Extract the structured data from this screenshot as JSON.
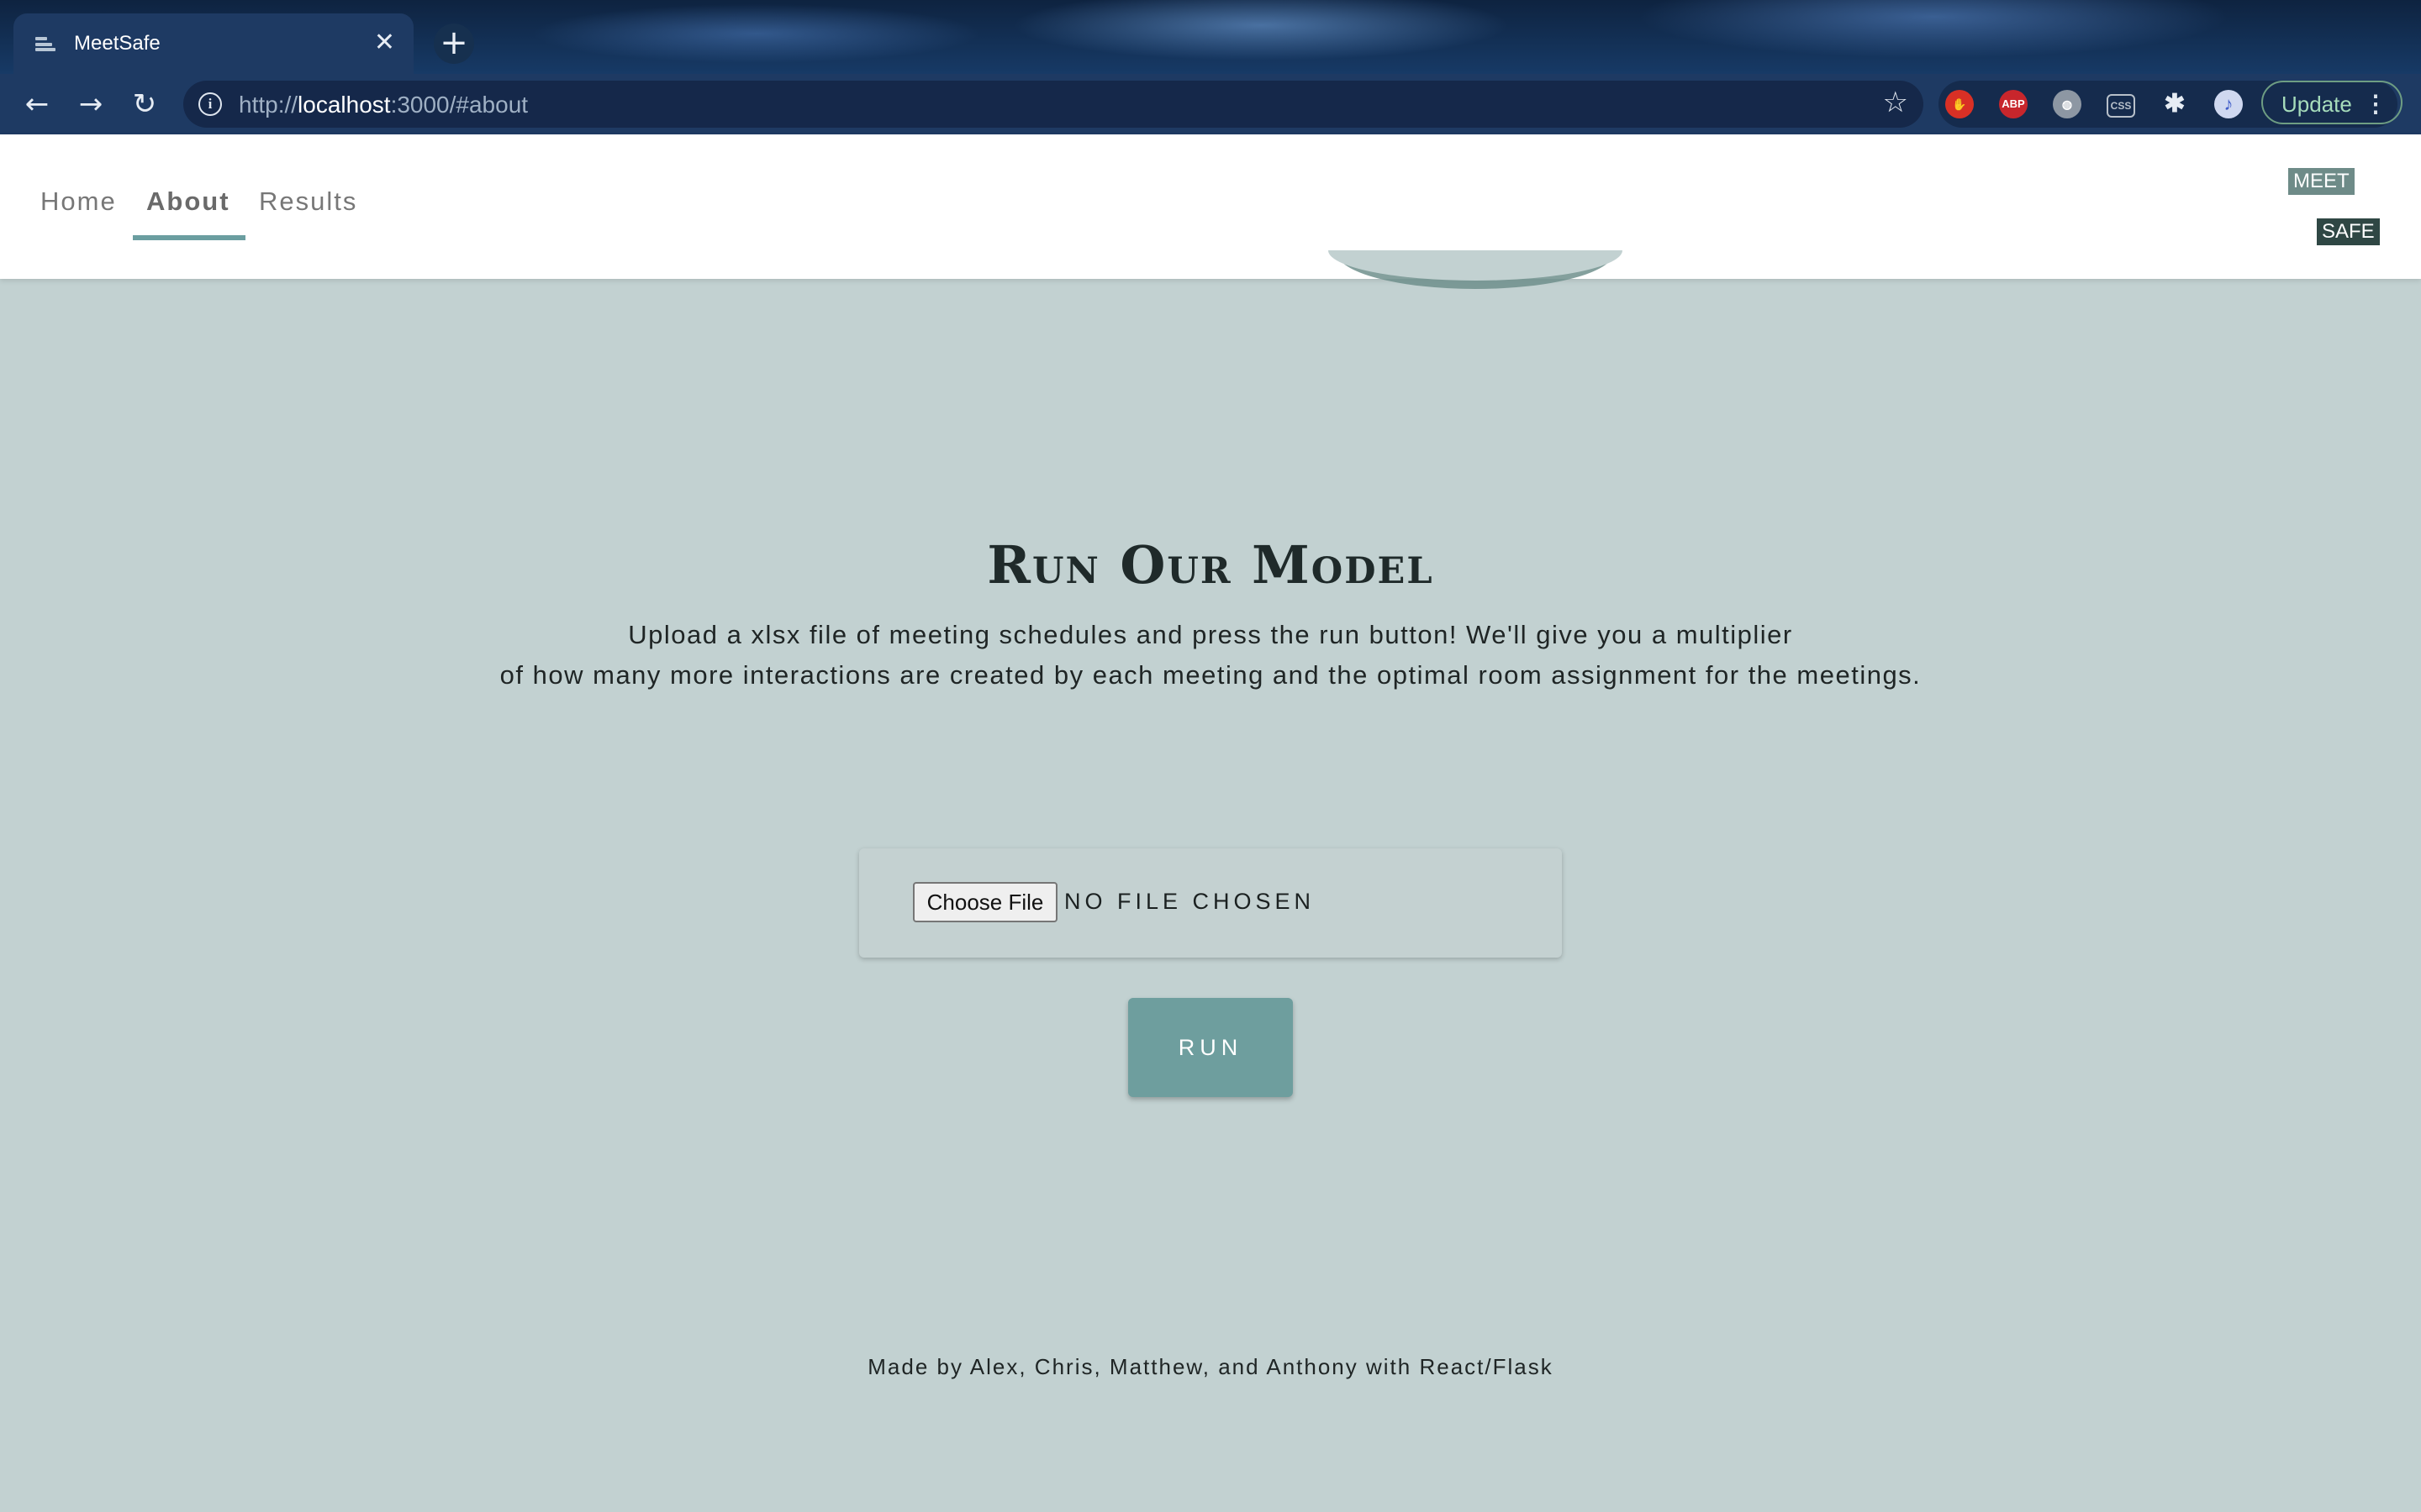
{
  "browser": {
    "tab_title": "MeetSafe",
    "tab_close": "✕",
    "new_tab": "+",
    "url_scheme": "http://",
    "url_host": "localhost",
    "url_rest": ":3000/#about",
    "update_label": "Update",
    "extensions": [
      {
        "name": "adblock-icon",
        "label": "",
        "color": "#d93025"
      },
      {
        "name": "abp-icon",
        "label": "ABP",
        "color": "#c8262c"
      },
      {
        "name": "globe-icon",
        "label": "",
        "color": "#9aa4ae"
      },
      {
        "name": "css-icon",
        "label": "CSS",
        "color": "#9aa4ae"
      },
      {
        "name": "puzzle-icon",
        "label": "",
        "color": "#e6ecf4"
      },
      {
        "name": "profile-avatar",
        "label": "",
        "color": "#cfd8f0"
      }
    ]
  },
  "header": {
    "nav": [
      {
        "label": "Home",
        "active": false
      },
      {
        "label": "About",
        "active": true
      },
      {
        "label": "Results",
        "active": false
      }
    ],
    "logo_top": "MEET",
    "logo_bottom": "SAFE"
  },
  "main": {
    "title": "Run Our Model",
    "description_line1": "Upload a xlsx file of meeting schedules and press the run button! We'll give you a multiplier",
    "description_line2": "of how many more interactions are created by each meeting and the optimal room assignment for the meetings.",
    "choose_file_label": "Choose File",
    "file_status": "NO FILE CHOSEN",
    "run_label": "RUN"
  },
  "footer": {
    "credit": "Made by Alex, Chris, Matthew, and Anthony with React/Flask"
  },
  "colors": {
    "page_bg": "#c2d1d1",
    "accent": "#6e9e9e",
    "browser_chrome": "#1e3a63"
  }
}
